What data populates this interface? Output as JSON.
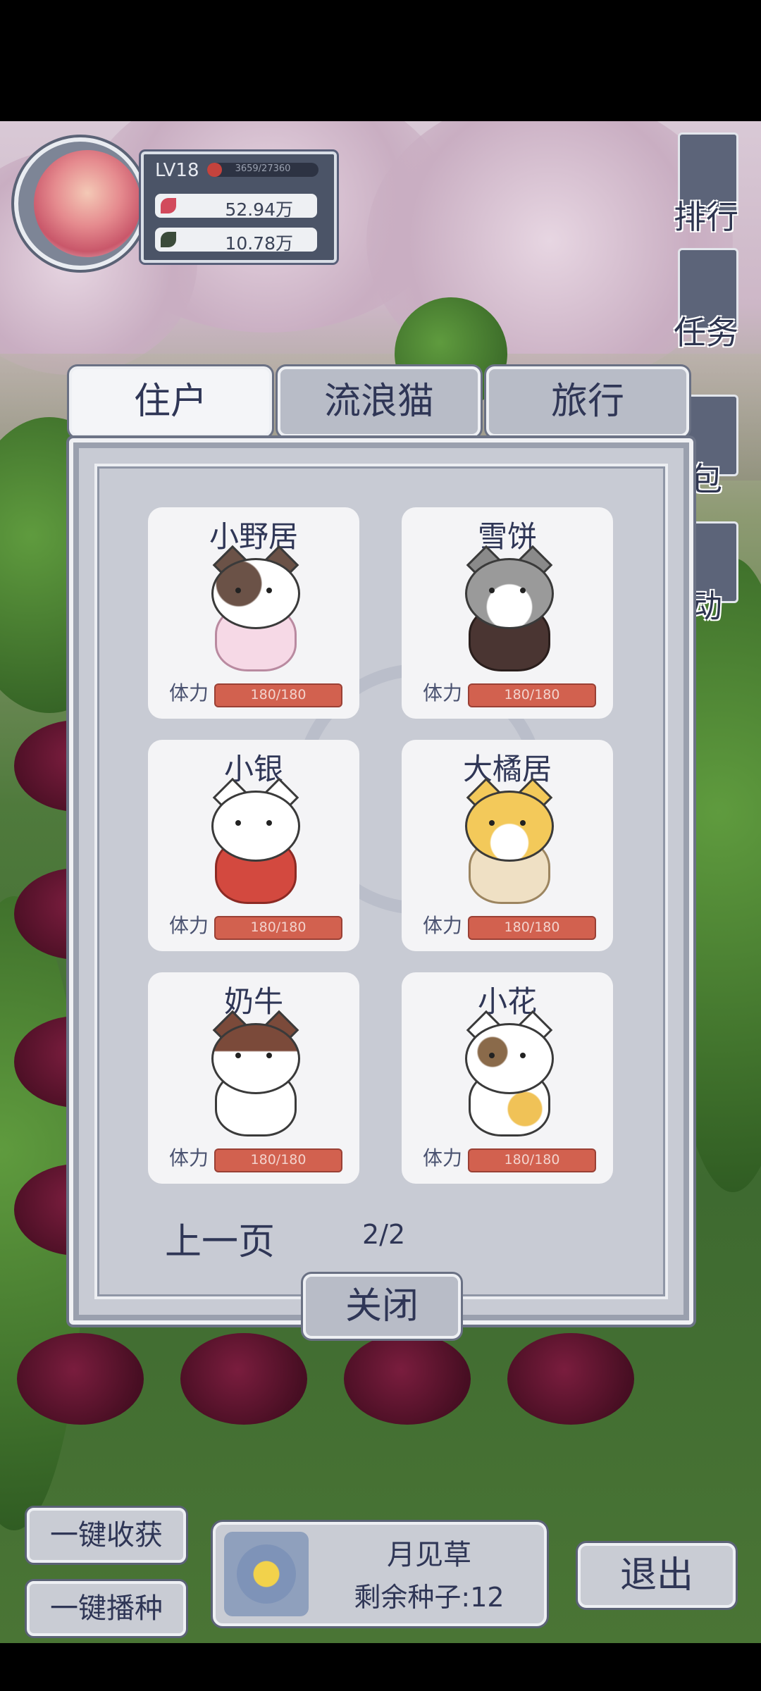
{
  "player": {
    "level": "LV18",
    "exp_text": "3659/27360",
    "exp_progress": 0.13,
    "resource1": "52.94万",
    "resource2": "10.78万"
  },
  "side_menu": {
    "ranking": "排行",
    "tasks": "任务",
    "bag": "包",
    "activity": "动"
  },
  "tabs": [
    "住户",
    "流浪猫",
    "旅行"
  ],
  "active_tab": 0,
  "stamina_label": "体力",
  "cats": [
    {
      "name": "小野居",
      "stamina": "180/180"
    },
    {
      "name": "雪饼",
      "stamina": "180/180"
    },
    {
      "name": "小银",
      "stamina": "180/180"
    },
    {
      "name": "大橘居",
      "stamina": "180/180"
    },
    {
      "name": "奶牛",
      "stamina": "180/180"
    },
    {
      "name": "小花",
      "stamina": "180/180"
    }
  ],
  "pager": {
    "prev_label": "上一页",
    "page": "2/2"
  },
  "close_label": "关闭",
  "bottom": {
    "harvest_all": "一键收获",
    "sow_all": "一键播种",
    "seed_name": "月见草",
    "seed_remaining": "剩余种子:12",
    "exit": "退出"
  },
  "colors": {
    "stamina_bar": "#d2614f",
    "ui_text": "#2f3656",
    "panel": "#c8cbd4"
  }
}
